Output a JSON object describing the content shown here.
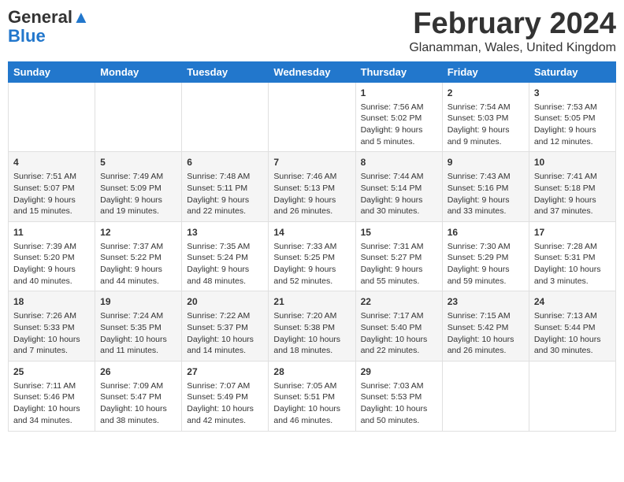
{
  "logo": {
    "line1": "General",
    "line2": "Blue"
  },
  "title": "February 2024",
  "subtitle": "Glanamman, Wales, United Kingdom",
  "days": [
    "Sunday",
    "Monday",
    "Tuesday",
    "Wednesday",
    "Thursday",
    "Friday",
    "Saturday"
  ],
  "weeks": [
    [
      {
        "num": "",
        "sunrise": "",
        "sunset": "",
        "daylight": ""
      },
      {
        "num": "",
        "sunrise": "",
        "sunset": "",
        "daylight": ""
      },
      {
        "num": "",
        "sunrise": "",
        "sunset": "",
        "daylight": ""
      },
      {
        "num": "",
        "sunrise": "",
        "sunset": "",
        "daylight": ""
      },
      {
        "num": "1",
        "sunrise": "Sunrise: 7:56 AM",
        "sunset": "Sunset: 5:02 PM",
        "daylight": "Daylight: 9 hours and 5 minutes."
      },
      {
        "num": "2",
        "sunrise": "Sunrise: 7:54 AM",
        "sunset": "Sunset: 5:03 PM",
        "daylight": "Daylight: 9 hours and 9 minutes."
      },
      {
        "num": "3",
        "sunrise": "Sunrise: 7:53 AM",
        "sunset": "Sunset: 5:05 PM",
        "daylight": "Daylight: 9 hours and 12 minutes."
      }
    ],
    [
      {
        "num": "4",
        "sunrise": "Sunrise: 7:51 AM",
        "sunset": "Sunset: 5:07 PM",
        "daylight": "Daylight: 9 hours and 15 minutes."
      },
      {
        "num": "5",
        "sunrise": "Sunrise: 7:49 AM",
        "sunset": "Sunset: 5:09 PM",
        "daylight": "Daylight: 9 hours and 19 minutes."
      },
      {
        "num": "6",
        "sunrise": "Sunrise: 7:48 AM",
        "sunset": "Sunset: 5:11 PM",
        "daylight": "Daylight: 9 hours and 22 minutes."
      },
      {
        "num": "7",
        "sunrise": "Sunrise: 7:46 AM",
        "sunset": "Sunset: 5:13 PM",
        "daylight": "Daylight: 9 hours and 26 minutes."
      },
      {
        "num": "8",
        "sunrise": "Sunrise: 7:44 AM",
        "sunset": "Sunset: 5:14 PM",
        "daylight": "Daylight: 9 hours and 30 minutes."
      },
      {
        "num": "9",
        "sunrise": "Sunrise: 7:43 AM",
        "sunset": "Sunset: 5:16 PM",
        "daylight": "Daylight: 9 hours and 33 minutes."
      },
      {
        "num": "10",
        "sunrise": "Sunrise: 7:41 AM",
        "sunset": "Sunset: 5:18 PM",
        "daylight": "Daylight: 9 hours and 37 minutes."
      }
    ],
    [
      {
        "num": "11",
        "sunrise": "Sunrise: 7:39 AM",
        "sunset": "Sunset: 5:20 PM",
        "daylight": "Daylight: 9 hours and 40 minutes."
      },
      {
        "num": "12",
        "sunrise": "Sunrise: 7:37 AM",
        "sunset": "Sunset: 5:22 PM",
        "daylight": "Daylight: 9 hours and 44 minutes."
      },
      {
        "num": "13",
        "sunrise": "Sunrise: 7:35 AM",
        "sunset": "Sunset: 5:24 PM",
        "daylight": "Daylight: 9 hours and 48 minutes."
      },
      {
        "num": "14",
        "sunrise": "Sunrise: 7:33 AM",
        "sunset": "Sunset: 5:25 PM",
        "daylight": "Daylight: 9 hours and 52 minutes."
      },
      {
        "num": "15",
        "sunrise": "Sunrise: 7:31 AM",
        "sunset": "Sunset: 5:27 PM",
        "daylight": "Daylight: 9 hours and 55 minutes."
      },
      {
        "num": "16",
        "sunrise": "Sunrise: 7:30 AM",
        "sunset": "Sunset: 5:29 PM",
        "daylight": "Daylight: 9 hours and 59 minutes."
      },
      {
        "num": "17",
        "sunrise": "Sunrise: 7:28 AM",
        "sunset": "Sunset: 5:31 PM",
        "daylight": "Daylight: 10 hours and 3 minutes."
      }
    ],
    [
      {
        "num": "18",
        "sunrise": "Sunrise: 7:26 AM",
        "sunset": "Sunset: 5:33 PM",
        "daylight": "Daylight: 10 hours and 7 minutes."
      },
      {
        "num": "19",
        "sunrise": "Sunrise: 7:24 AM",
        "sunset": "Sunset: 5:35 PM",
        "daylight": "Daylight: 10 hours and 11 minutes."
      },
      {
        "num": "20",
        "sunrise": "Sunrise: 7:22 AM",
        "sunset": "Sunset: 5:37 PM",
        "daylight": "Daylight: 10 hours and 14 minutes."
      },
      {
        "num": "21",
        "sunrise": "Sunrise: 7:20 AM",
        "sunset": "Sunset: 5:38 PM",
        "daylight": "Daylight: 10 hours and 18 minutes."
      },
      {
        "num": "22",
        "sunrise": "Sunrise: 7:17 AM",
        "sunset": "Sunset: 5:40 PM",
        "daylight": "Daylight: 10 hours and 22 minutes."
      },
      {
        "num": "23",
        "sunrise": "Sunrise: 7:15 AM",
        "sunset": "Sunset: 5:42 PM",
        "daylight": "Daylight: 10 hours and 26 minutes."
      },
      {
        "num": "24",
        "sunrise": "Sunrise: 7:13 AM",
        "sunset": "Sunset: 5:44 PM",
        "daylight": "Daylight: 10 hours and 30 minutes."
      }
    ],
    [
      {
        "num": "25",
        "sunrise": "Sunrise: 7:11 AM",
        "sunset": "Sunset: 5:46 PM",
        "daylight": "Daylight: 10 hours and 34 minutes."
      },
      {
        "num": "26",
        "sunrise": "Sunrise: 7:09 AM",
        "sunset": "Sunset: 5:47 PM",
        "daylight": "Daylight: 10 hours and 38 minutes."
      },
      {
        "num": "27",
        "sunrise": "Sunrise: 7:07 AM",
        "sunset": "Sunset: 5:49 PM",
        "daylight": "Daylight: 10 hours and 42 minutes."
      },
      {
        "num": "28",
        "sunrise": "Sunrise: 7:05 AM",
        "sunset": "Sunset: 5:51 PM",
        "daylight": "Daylight: 10 hours and 46 minutes."
      },
      {
        "num": "29",
        "sunrise": "Sunrise: 7:03 AM",
        "sunset": "Sunset: 5:53 PM",
        "daylight": "Daylight: 10 hours and 50 minutes."
      },
      {
        "num": "",
        "sunrise": "",
        "sunset": "",
        "daylight": ""
      },
      {
        "num": "",
        "sunrise": "",
        "sunset": "",
        "daylight": ""
      }
    ]
  ]
}
